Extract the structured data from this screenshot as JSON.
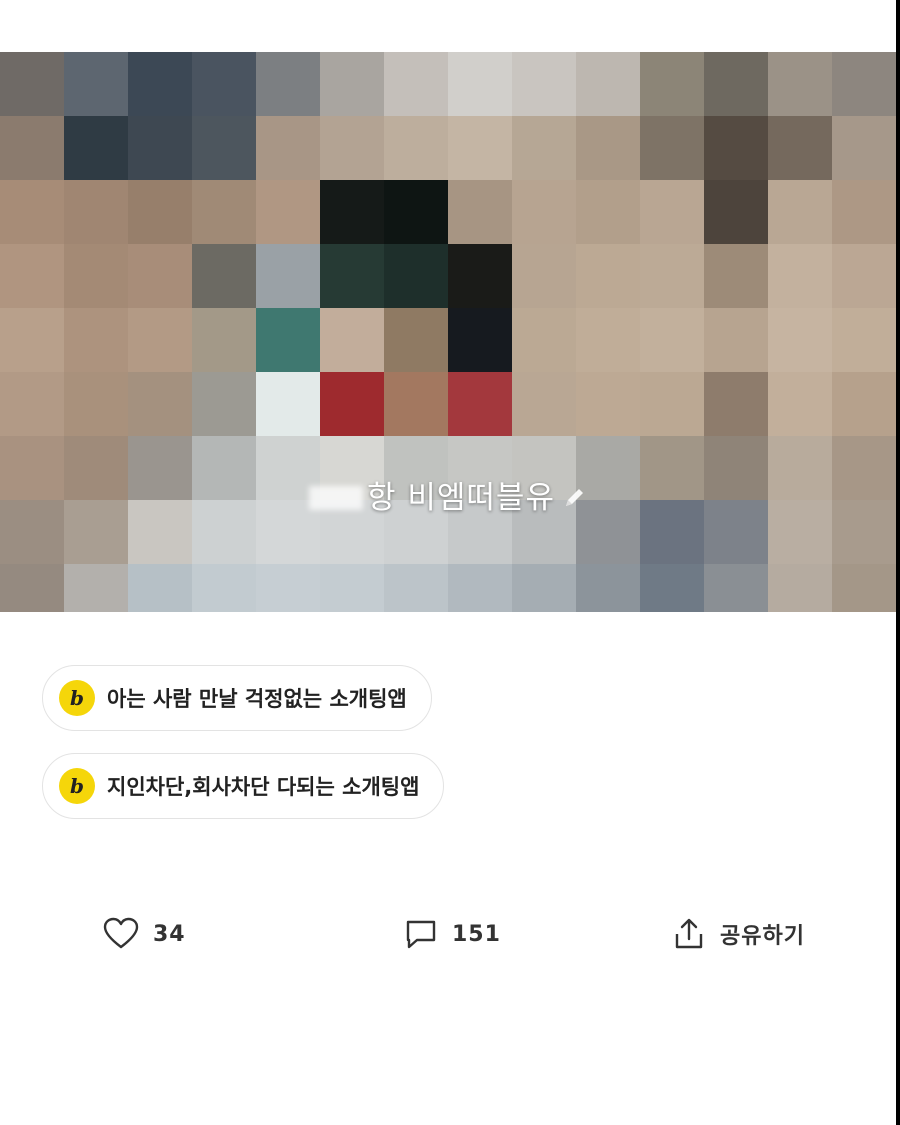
{
  "photo": {
    "caption_blurred_name": "",
    "caption_text": "항 비엠떠블유",
    "caption_icon": "pencil-icon"
  },
  "links": [
    {
      "logo_letter": "b",
      "label": "아는 사람 만날 걱정없는 소개팅앱",
      "logo_color": "#f5d60a"
    },
    {
      "logo_letter": "b",
      "label": "지인차단,회사차단 다되는 소개팅앱",
      "logo_color": "#f5d60a"
    }
  ],
  "actions": {
    "like": {
      "icon": "heart-icon",
      "count": "34"
    },
    "comment": {
      "icon": "comment-icon",
      "count": "151"
    },
    "share": {
      "icon": "share-icon",
      "label": "공유하기"
    }
  }
}
